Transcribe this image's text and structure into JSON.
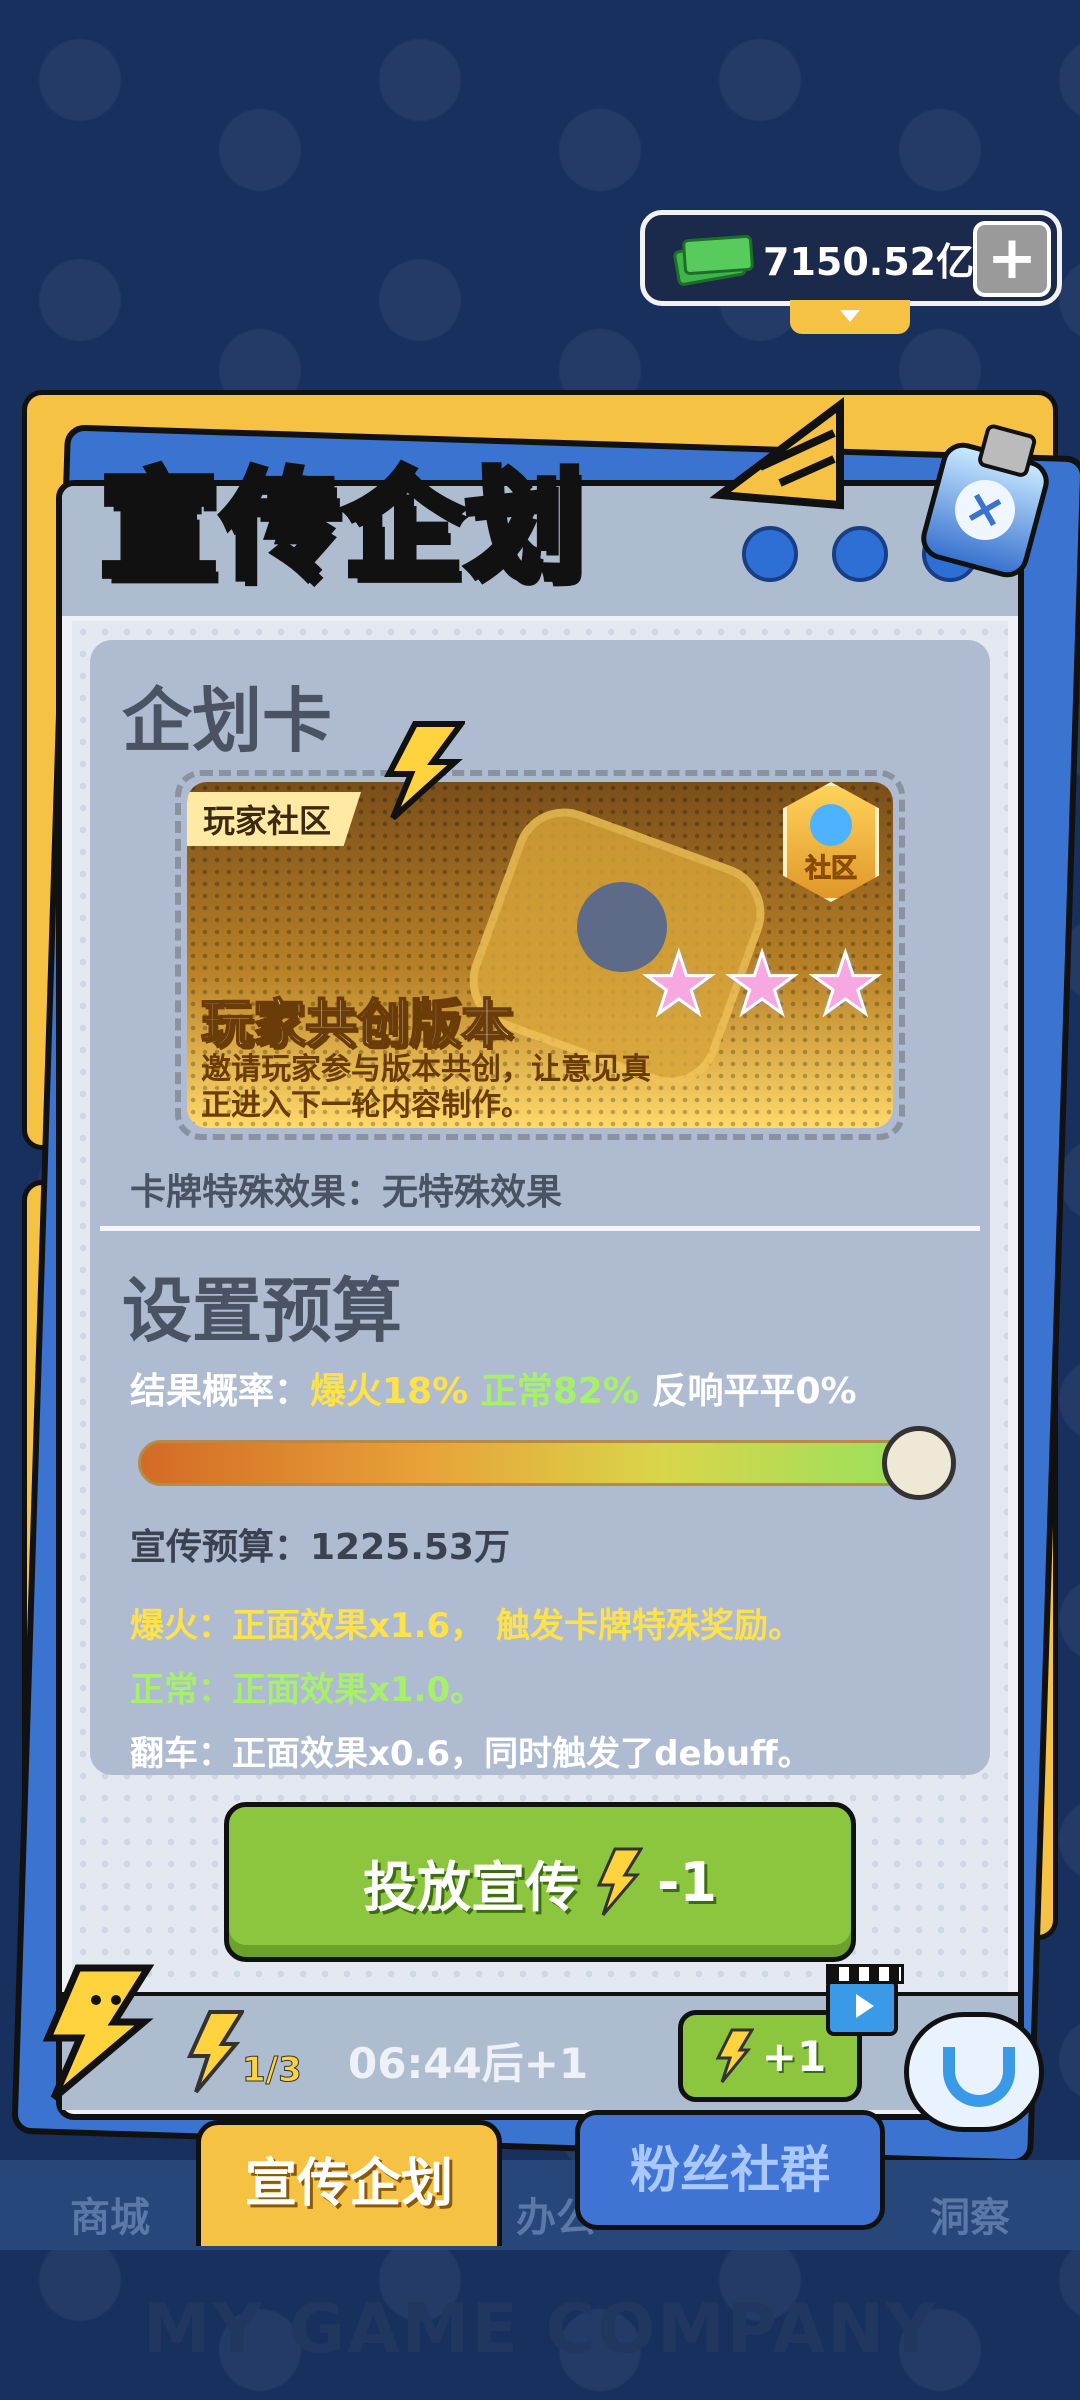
{
  "currency": {
    "amount": "7150.52亿",
    "plus": "+",
    "icon": "money-icon"
  },
  "panel": {
    "title": "宣传企划",
    "close_icon": "×",
    "card_section": "企划卡",
    "card": {
      "tag": "玩家社区",
      "badge": "社区",
      "title": "玩家共创版本",
      "description": "邀请玩家参与版本共创，让意见真正进入下一轮内容制作。",
      "stars": [
        "★",
        "★",
        "★"
      ]
    },
    "card_effect": "卡牌特殊效果：无特殊效果",
    "budget_section": "设置预算",
    "probability": {
      "label": "结果概率：",
      "hot": "爆火18%",
      "normal": "正常82%",
      "flat": "反响平平0%"
    },
    "slider": {
      "value_fraction": 1.0
    },
    "budget": "宣传预算：1225.53万",
    "rules": {
      "hot": "爆火：正面效果x1.6， 触发卡牌特殊奖励。",
      "normal": "正常：正面效果x1.0。",
      "flop": "翻车：正面效果x0.6，同时触发了debuff。"
    },
    "cta": {
      "label": "投放宣传",
      "cost": "-1"
    },
    "footer": {
      "energy": "1/3",
      "timer": "06:44后+1",
      "refill": "+1"
    }
  },
  "nav": {
    "shop": "商城",
    "active": "宣传企划",
    "office": "办公",
    "fans": "粉丝社群",
    "insight": "洞察"
  },
  "brand": "MY GAME COMPANY",
  "colors": {
    "accent_yellow": "#f5c243",
    "green_button": "#8cc63f",
    "panel_blue": "#3a74d0"
  }
}
